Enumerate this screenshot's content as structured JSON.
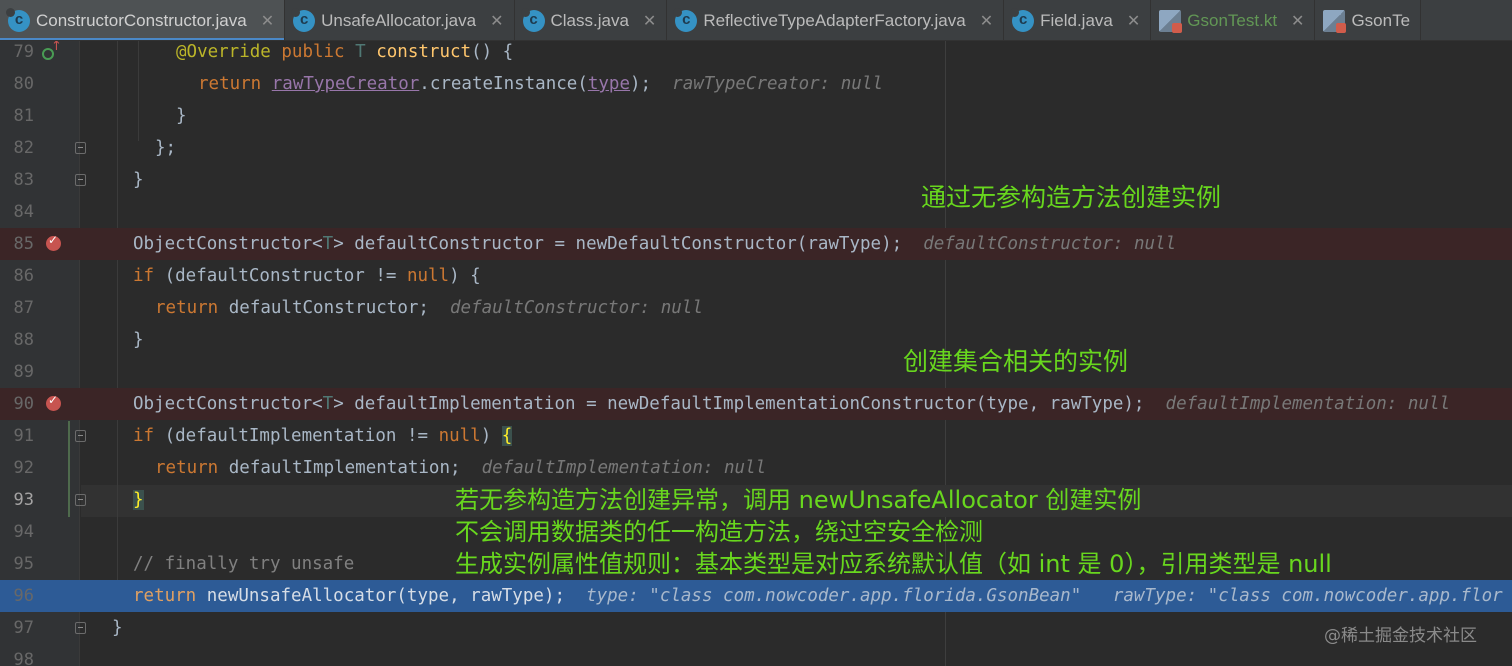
{
  "tabs": [
    {
      "label": "ConstructorConstructor.java",
      "icon": "java-class-icon",
      "active": true
    },
    {
      "label": "UnsafeAllocator.java",
      "icon": "java-class-icon"
    },
    {
      "label": "Class.java",
      "icon": "java-class-icon"
    },
    {
      "label": "ReflectiveTypeAdapterFactory.java",
      "icon": "java-class-icon"
    },
    {
      "label": "Field.java",
      "icon": "java-class-icon"
    },
    {
      "label": "GsonTest.kt",
      "icon": "kotlin-file-icon"
    },
    {
      "label": "GsonTe",
      "icon": "kotlin-file-icon"
    }
  ],
  "line_numbers": [
    "79",
    "80",
    "81",
    "82",
    "83",
    "84",
    "85",
    "86",
    "87",
    "88",
    "89",
    "90",
    "91",
    "92",
    "93",
    "94",
    "95",
    "96",
    "97",
    "98"
  ],
  "code": {
    "l79": {
      "ann": "@Override",
      "kw": "public",
      "tp": "T",
      "fn": "construct",
      "rest": "() {"
    },
    "l80": {
      "kw": "return",
      "fld": "rawTypeCreator",
      "mid": ".createInstance(",
      "prm": "type",
      "end": ");",
      "hint": "rawTypeCreator: null"
    },
    "l81": "}",
    "l82": "};",
    "l83": "}",
    "l85": {
      "a": "ObjectConstructor<",
      "tp": "T",
      "b": "> defaultConstructor = newDefaultConstructor(rawType);",
      "hint": "defaultConstructor: null"
    },
    "l86": {
      "kw": "if",
      "a": " (defaultConstructor != ",
      "kw2": "null",
      "b": ") {"
    },
    "l87": {
      "kw": "return",
      "a": " defaultConstructor;",
      "hint": "defaultConstructor: null"
    },
    "l88": "}",
    "l90": {
      "a": "ObjectConstructor<",
      "tp": "T",
      "b": "> defaultImplementation = newDefaultImplementationConstructor(type, rawType);",
      "hint": "defaultImplementation: null"
    },
    "l91": {
      "kw": "if",
      "a": " (defaultImplementation != ",
      "kw2": "null",
      "b": ") ",
      "brace": "{"
    },
    "l92": {
      "kw": "return",
      "a": " defaultImplementation;",
      "hint": "defaultImplementation: null"
    },
    "l93": "}",
    "l95": "// finally try unsafe",
    "l96": {
      "kw": "return",
      "a": " newUnsafeAllocator(type, rawType);",
      "hint": "type: \"class com.nowcoder.app.florida.GsonBean\"   rawType: \"class com.nowcoder.app.flor"
    },
    "l97": "}"
  },
  "annotations": {
    "note1": "通过无参构造方法创建实例",
    "note2": "创建集合相关的实例",
    "note3_line1": "若无参构造方法创建异常，调用 newUnsafeAllocator 创建实例",
    "note3_line2": "不会调用数据类的任一构造方法，绕过空安全检测",
    "note3_line3": "生成实例属性值规则：基本类型是对应系统默认值（如 int 是 0），引用类型是 null"
  },
  "watermark": "@稀土掘金技术社区",
  "colors": {
    "annotation_text": "#68d71e",
    "breakpoint": "#c75450",
    "execution_line": "#2d5b96"
  }
}
